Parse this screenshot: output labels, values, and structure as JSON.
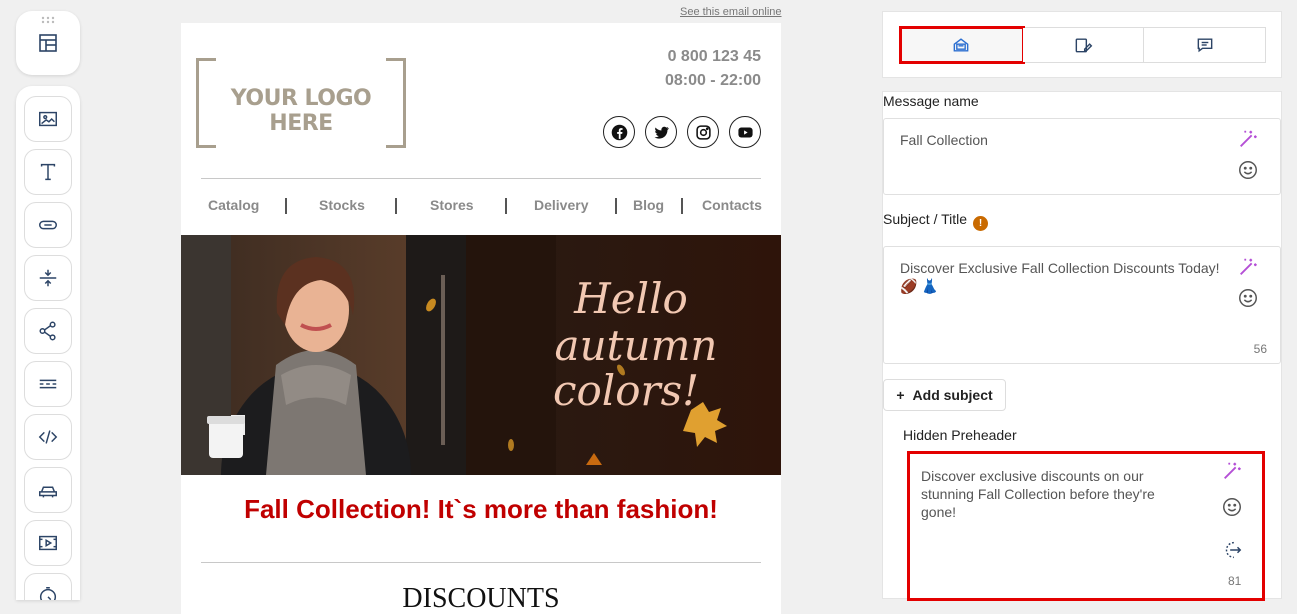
{
  "toolbar": {
    "top_icon": "layout-icon",
    "tools": [
      "image-icon",
      "text-icon",
      "button-icon",
      "spacer-icon",
      "share-icon",
      "divider-icon",
      "code-icon",
      "product-icon",
      "video-icon",
      "timer-icon"
    ]
  },
  "email": {
    "see_online": "See this email online",
    "logo_text": "YOUR LOGO HERE",
    "phone": "0 800 123 45",
    "hours": "08:00 - 22:00",
    "socials": [
      "facebook-icon",
      "twitter-icon",
      "instagram-icon",
      "youtube-icon"
    ],
    "nav": [
      "Catalog",
      "Stocks",
      "Stores",
      "Delivery",
      "Blog",
      "Contacts"
    ],
    "hero": {
      "line1": "Hello",
      "line2": "autumn",
      "line3": "colors!"
    },
    "headline": "Fall Collection! It`s more than fashion!",
    "section_title": "DISCOUNTS"
  },
  "panel": {
    "tabs": [
      "email-settings-tab",
      "preview-tab",
      "comments-tab"
    ],
    "message_name_label": "Message name",
    "message_name_value": "Fall Collection",
    "subject_label": "Subject / Title",
    "subject_value": "Discover Exclusive Fall Collection Discounts Today! 🏈 👗",
    "subject_counter": "56",
    "add_subject": "Add subject",
    "preheader_label": "Hidden Preheader",
    "preheader_value": "Discover exclusive discounts on our stunning Fall Collection before they're gone!",
    "preheader_counter": "81"
  },
  "colors": {
    "accent_red": "#e30000",
    "headline_red": "#c00000",
    "logo_taupe": "#a89f8e",
    "ai_purple": "#b44fd6"
  }
}
